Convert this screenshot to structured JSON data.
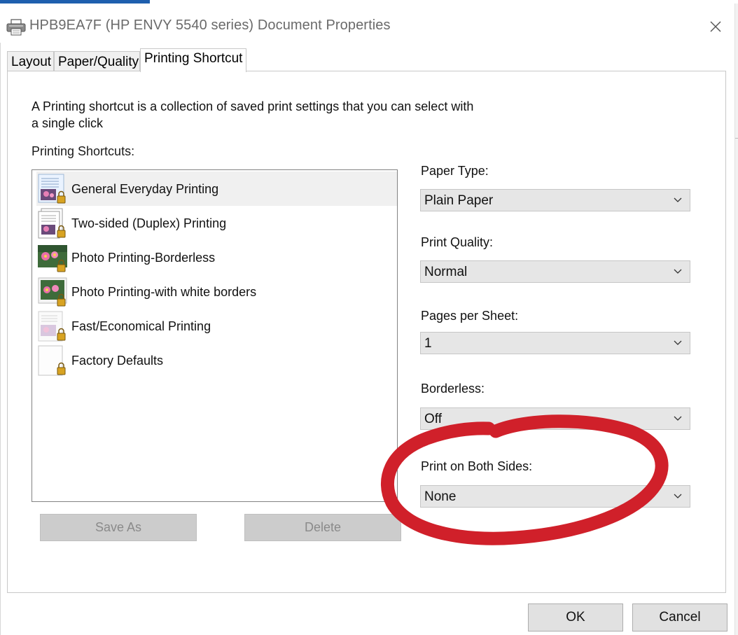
{
  "window": {
    "title": "HPB9EA7F (HP ENVY 5540 series) Document Properties"
  },
  "tabs": [
    {
      "label": "Layout"
    },
    {
      "label": "Paper/Quality"
    },
    {
      "label": "Printing Shortcut",
      "active": true
    }
  ],
  "shortcut_panel": {
    "description": "A Printing shortcut is a collection of saved print settings that you can select with a single click",
    "list_label": "Printing Shortcuts:",
    "items": [
      {
        "label": "General Everyday Printing",
        "icon": "document-lock-icon",
        "selected": true
      },
      {
        "label": "Two-sided (Duplex) Printing",
        "icon": "duplex-document-lock-icon"
      },
      {
        "label": "Photo Printing-Borderless",
        "icon": "flower-photo-lock-icon"
      },
      {
        "label": "Photo Printing-with white borders",
        "icon": "bordered-photo-lock-icon"
      },
      {
        "label": "Fast/Economical Printing",
        "icon": "faded-document-lock-icon"
      },
      {
        "label": "Factory Defaults",
        "icon": "blank-page-lock-icon"
      }
    ],
    "save_as_label": "Save As",
    "delete_label": "Delete"
  },
  "settings": {
    "paper_type": {
      "label": "Paper Type:",
      "value": "Plain Paper"
    },
    "print_quality": {
      "label": "Print Quality:",
      "value": "Normal"
    },
    "pages_per_sheet": {
      "label": "Pages per Sheet:",
      "value": "1"
    },
    "borderless": {
      "label": "Borderless:",
      "value": "Off"
    },
    "print_both_sides": {
      "label": "Print on Both Sides:",
      "value": "None"
    }
  },
  "footer": {
    "ok_label": "OK",
    "cancel_label": "Cancel"
  },
  "annotation": {
    "color": "#d0202a",
    "shape": "hand-drawn circle around Print on Both Sides"
  },
  "colors": {
    "accent_bar": "#1f5fae",
    "selection_bg": "#f0f0f0",
    "disabled_button": "#cccccc"
  }
}
